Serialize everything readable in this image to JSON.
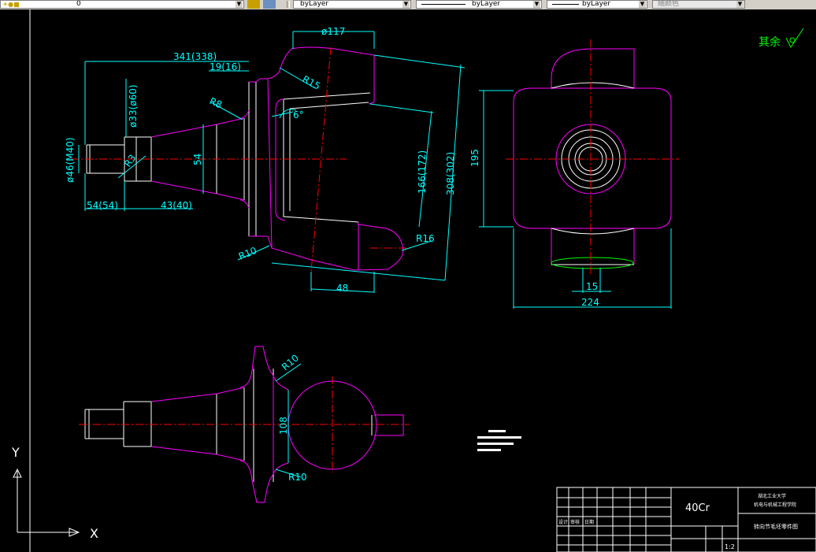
{
  "toolbar": {
    "layer_value": "0",
    "color_value": "byLayer",
    "linetype_value": "byLayer",
    "lineweight_value": "byLayer",
    "plotstyle_value": "随颜色"
  },
  "drawing": {
    "roughness_note": "其余",
    "dims": {
      "d117": "ø117",
      "d341": "341(338)",
      "d19": "19(16)",
      "r15": "R15",
      "r8": "R8",
      "d33": "ø33(ø60)",
      "ang6": "6°",
      "d46": "ø46(M40)",
      "r3": "R3",
      "d54v": "54",
      "d166": "166(172)",
      "d308": "308(302)",
      "d54h": "54(54)",
      "d43": "43(40)",
      "r10a": "R10",
      "r16": "R16",
      "d48": "48",
      "d195": "195",
      "d15": "15",
      "d224": "224",
      "r10b": "R10",
      "r10c": "R10",
      "d108": "108"
    },
    "ucs": {
      "y": "Y",
      "x": "X"
    },
    "title_block": {
      "material": "40Cr",
      "school": "湖北工业大学",
      "dept": "机电与机械工程学院",
      "part_name": "转向节毛坯零件图",
      "scale": "1:2",
      "row_labels": [
        "设计",
        "审核",
        "日期"
      ]
    }
  }
}
